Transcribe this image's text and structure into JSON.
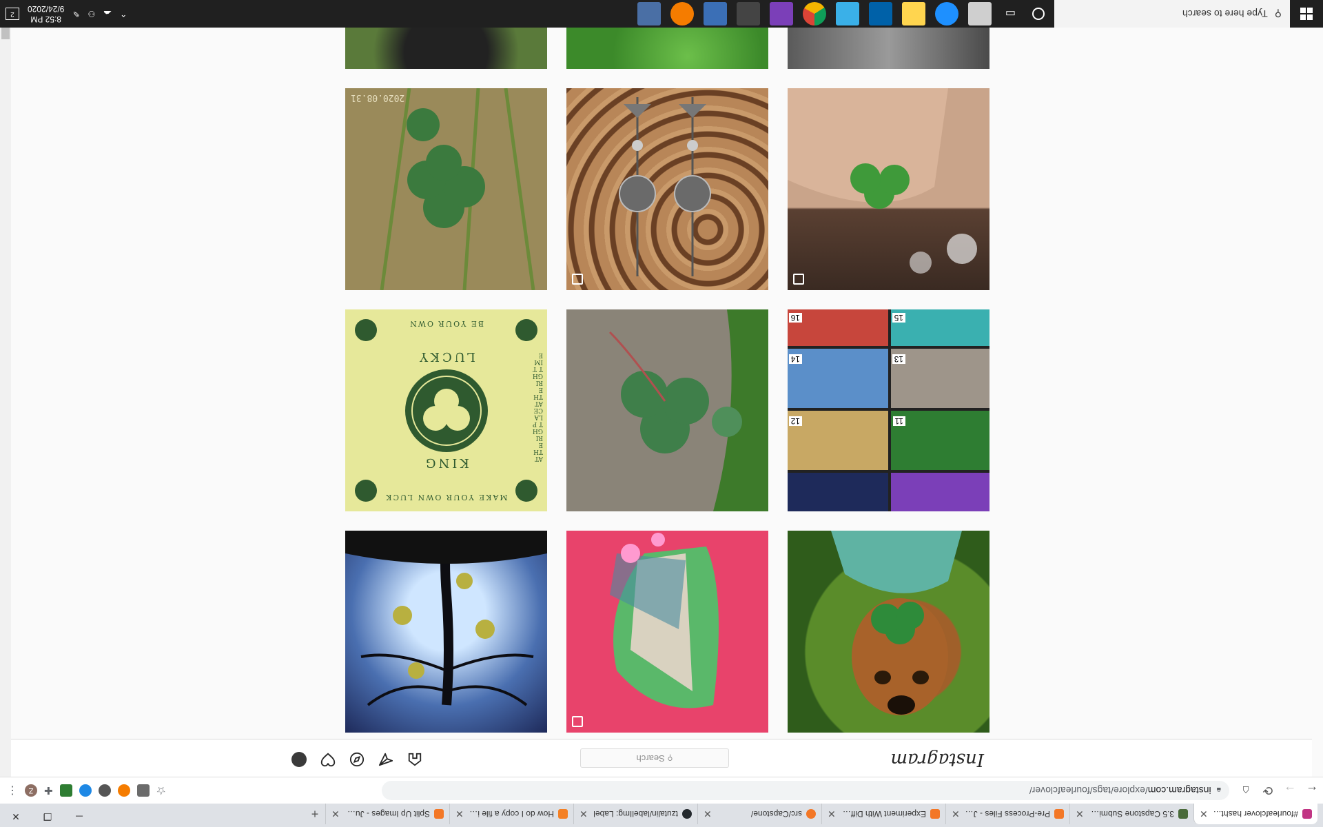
{
  "browser": {
    "tabs": [
      {
        "title": "#fourleafclover hashtag on",
        "active": true,
        "color": "#c13584"
      },
      {
        "title": "3.5 Capstone Submission -",
        "active": false,
        "color": "#4a6b3a"
      },
      {
        "title": "Pre-Process Files - Jupyter",
        "active": false,
        "color": "#f37726"
      },
      {
        "title": "Experiment With Different",
        "active": false,
        "color": "#f37726"
      },
      {
        "title": "src/Capstone/",
        "active": false,
        "color": "#f37726"
      },
      {
        "title": "tzutalin/labelImg: Label",
        "active": false,
        "color": "#24292e"
      },
      {
        "title": "How do I copy a file in Pyth",
        "active": false,
        "color": "#f48024"
      },
      {
        "title": "Split Up Images - Jupyter N",
        "active": false,
        "color": "#f37726"
      }
    ],
    "new_tab_label": "+",
    "window_controls": [
      "─",
      "❐",
      "✕"
    ],
    "address": {
      "host": "instagram.com",
      "path": "/explore/tags/fourleafclover/"
    },
    "extension_colors": [
      "#6b6b6b",
      "#1a73e8",
      "#2e7d32",
      "#555555",
      "#1e88e5",
      "#999999",
      "#f57c00",
      "#777777"
    ],
    "profile_initial": "Z"
  },
  "instagram": {
    "logo_text": "Instagram",
    "search_placeholder": "Search"
  },
  "posts": [
    {
      "id": "dog-clover",
      "desc": "dog",
      "multi": false
    },
    {
      "id": "anime-pink",
      "desc": "art",
      "multi": true
    },
    {
      "id": "tree-roots",
      "desc": "art",
      "multi": false
    },
    {
      "id": "fabric-grid",
      "desc": "fabric",
      "multi": false,
      "labels": [
        "11",
        "12",
        "13",
        "14",
        "15",
        "16"
      ]
    },
    {
      "id": "clover-ground",
      "desc": "clover",
      "multi": false
    },
    {
      "id": "lucky-king",
      "desc": "card",
      "multi": false,
      "text": {
        "top": "MAKE YOUR OWN LUCK",
        "bottom": "BE YOUR OWN",
        "king": "KING",
        "lucky": "LUCKY",
        "side": "AT THE RIGHT PLACE AT THE RIGHT TIME"
      }
    },
    {
      "id": "hand-clover",
      "desc": "clover",
      "multi": true
    },
    {
      "id": "earrings",
      "desc": "jewelry",
      "multi": true
    },
    {
      "id": "clover-grass",
      "desc": "clover",
      "multi": false,
      "stamp": "2020.08.31"
    },
    {
      "id": "rock-top",
      "desc": "rock",
      "multi": false
    },
    {
      "id": "clover-top",
      "desc": "clover",
      "multi": false
    },
    {
      "id": "dark-top",
      "desc": "ground",
      "multi": false
    }
  ],
  "taskbar": {
    "search_placeholder": "Type here to search",
    "app_colors": [
      "#cfcfcf",
      "#1e90ff",
      "#ffd54f",
      "#0061a8",
      "#3ab0e8",
      "#4fc3f7",
      "#4285f4",
      "#7b3fb8",
      "#444444",
      "#3b6fb6",
      "#f57c00",
      "#4a6fa5"
    ],
    "time": "8:52 PM",
    "date": "9/24/2020",
    "notifications": "2"
  }
}
